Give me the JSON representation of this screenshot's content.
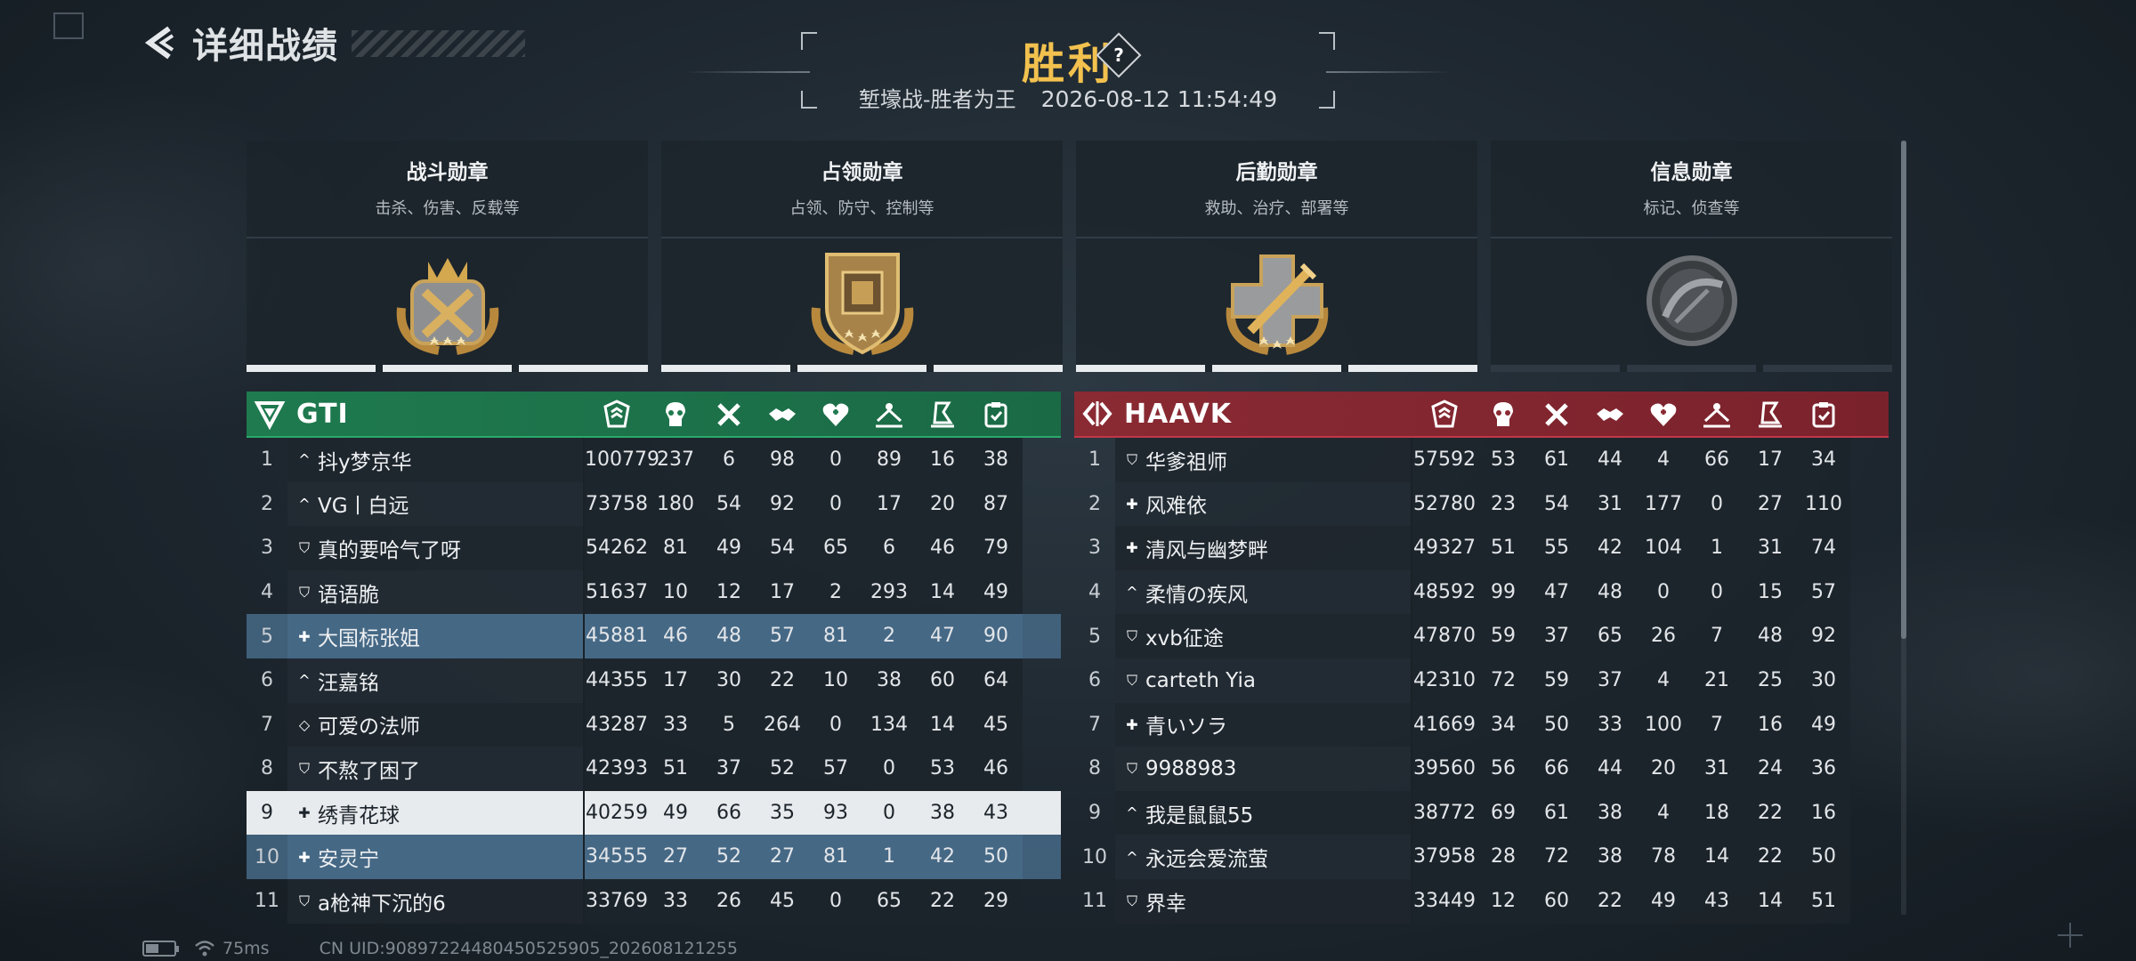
{
  "header": {
    "back_title": "详细战绩",
    "result": "胜利",
    "help": "?",
    "mode": "堑壕战-胜者为王",
    "datetime": "2026-08-12 11:54:49"
  },
  "medals": [
    {
      "name": "战斗勋章",
      "desc": "击杀、伤害、反载等",
      "icon": "combat-medal-icon",
      "progress": 1.0
    },
    {
      "name": "占领勋章",
      "desc": "占领、防守、控制等",
      "icon": "capture-medal-icon",
      "progress": 1.0
    },
    {
      "name": "后勤勋章",
      "desc": "救助、治疗、部署等",
      "icon": "logistics-medal-icon",
      "progress": 1.0
    },
    {
      "name": "信息勋章",
      "desc": "标记、侦查等",
      "icon": "intel-medal-icon",
      "progress": 0.0
    }
  ],
  "columns": [
    "score-icon",
    "kills-icon",
    "deaths-icon",
    "assists-icon",
    "revives-icon",
    "objective-icon",
    "capture-icon",
    "support-icon"
  ],
  "teams": {
    "left": {
      "name": "GTI",
      "color": "#1f7a4f",
      "rows": [
        {
          "n": "1",
          "rank": "^",
          "name": "抖y梦京华",
          "stats": [
            "100779",
            "237",
            "6",
            "98",
            "0",
            "89",
            "16",
            "38"
          ],
          "hl": ""
        },
        {
          "n": "2",
          "rank": "^",
          "name": "VG丨白远",
          "stats": [
            "73758",
            "180",
            "54",
            "92",
            "0",
            "17",
            "20",
            "87"
          ],
          "hl": ""
        },
        {
          "n": "3",
          "rank": "⛉",
          "name": "真的要哈气了呀",
          "stats": [
            "54262",
            "81",
            "49",
            "54",
            "65",
            "6",
            "46",
            "79"
          ],
          "hl": ""
        },
        {
          "n": "4",
          "rank": "⛉",
          "name": "语语脆",
          "stats": [
            "51637",
            "10",
            "12",
            "17",
            "2",
            "293",
            "14",
            "49"
          ],
          "hl": ""
        },
        {
          "n": "5",
          "rank": "✚",
          "name": "大国标张姐",
          "stats": [
            "45881",
            "46",
            "48",
            "57",
            "81",
            "2",
            "47",
            "90"
          ],
          "hl": "blue"
        },
        {
          "n": "6",
          "rank": "^",
          "name": "汪嘉铭",
          "stats": [
            "44355",
            "17",
            "30",
            "22",
            "10",
            "38",
            "60",
            "64"
          ],
          "hl": ""
        },
        {
          "n": "7",
          "rank": "◇",
          "name": "可爱の法师",
          "stats": [
            "43287",
            "33",
            "5",
            "264",
            "0",
            "134",
            "14",
            "45"
          ],
          "hl": ""
        },
        {
          "n": "8",
          "rank": "⛉",
          "name": "不熬了困了",
          "stats": [
            "42393",
            "51",
            "37",
            "52",
            "57",
            "0",
            "53",
            "46"
          ],
          "hl": ""
        },
        {
          "n": "9",
          "rank": "✚",
          "name": "绣青花球",
          "stats": [
            "40259",
            "49",
            "66",
            "35",
            "93",
            "0",
            "38",
            "43"
          ],
          "hl": "white"
        },
        {
          "n": "10",
          "rank": "✚",
          "name": "安灵宁",
          "stats": [
            "34555",
            "27",
            "52",
            "27",
            "81",
            "1",
            "42",
            "50"
          ],
          "hl": "blue"
        },
        {
          "n": "11",
          "rank": "⛉",
          "name": "a枪神下沉的6",
          "stats": [
            "33769",
            "33",
            "26",
            "45",
            "0",
            "65",
            "22",
            "29"
          ],
          "hl": ""
        }
      ]
    },
    "right": {
      "name": "HAAVK",
      "color": "#8a2a33",
      "rows": [
        {
          "n": "1",
          "rank": "⛉",
          "name": "华爹祖师",
          "stats": [
            "57592",
            "53",
            "61",
            "44",
            "4",
            "66",
            "17",
            "34"
          ],
          "hl": ""
        },
        {
          "n": "2",
          "rank": "✚",
          "name": "风难依",
          "stats": [
            "52780",
            "23",
            "54",
            "31",
            "177",
            "0",
            "27",
            "110"
          ],
          "hl": ""
        },
        {
          "n": "3",
          "rank": "✚",
          "name": "清风与幽梦畔",
          "stats": [
            "49327",
            "51",
            "55",
            "42",
            "104",
            "1",
            "31",
            "74"
          ],
          "hl": ""
        },
        {
          "n": "4",
          "rank": "^",
          "name": "柔情の疾风",
          "stats": [
            "48592",
            "99",
            "47",
            "48",
            "0",
            "0",
            "15",
            "57"
          ],
          "hl": ""
        },
        {
          "n": "5",
          "rank": "⛉",
          "name": "xvb征途",
          "stats": [
            "47870",
            "59",
            "37",
            "65",
            "26",
            "7",
            "48",
            "92"
          ],
          "hl": ""
        },
        {
          "n": "6",
          "rank": "⛉",
          "name": "carteth Yia",
          "stats": [
            "42310",
            "72",
            "59",
            "37",
            "4",
            "21",
            "25",
            "30"
          ],
          "hl": ""
        },
        {
          "n": "7",
          "rank": "✚",
          "name": "青いソラ",
          "stats": [
            "41669",
            "34",
            "50",
            "33",
            "100",
            "7",
            "16",
            "49"
          ],
          "hl": ""
        },
        {
          "n": "8",
          "rank": "⛉",
          "name": "9988983",
          "stats": [
            "39560",
            "56",
            "66",
            "44",
            "20",
            "31",
            "24",
            "36"
          ],
          "hl": ""
        },
        {
          "n": "9",
          "rank": "^",
          "name": "我是鼠鼠55",
          "stats": [
            "38772",
            "69",
            "61",
            "38",
            "4",
            "18",
            "22",
            "16"
          ],
          "hl": ""
        },
        {
          "n": "10",
          "rank": "^",
          "name": "永远会爱流萤",
          "stats": [
            "37958",
            "28",
            "72",
            "38",
            "78",
            "14",
            "22",
            "50"
          ],
          "hl": ""
        },
        {
          "n": "11",
          "rank": "⛉",
          "name": "界幸",
          "stats": [
            "33449",
            "12",
            "60",
            "22",
            "49",
            "43",
            "14",
            "51"
          ],
          "hl": ""
        }
      ]
    }
  },
  "footer": {
    "ping": "75ms",
    "uid": "CN UID:9089722448045052590​5_202608121255",
    "battery_level": 0.45
  }
}
